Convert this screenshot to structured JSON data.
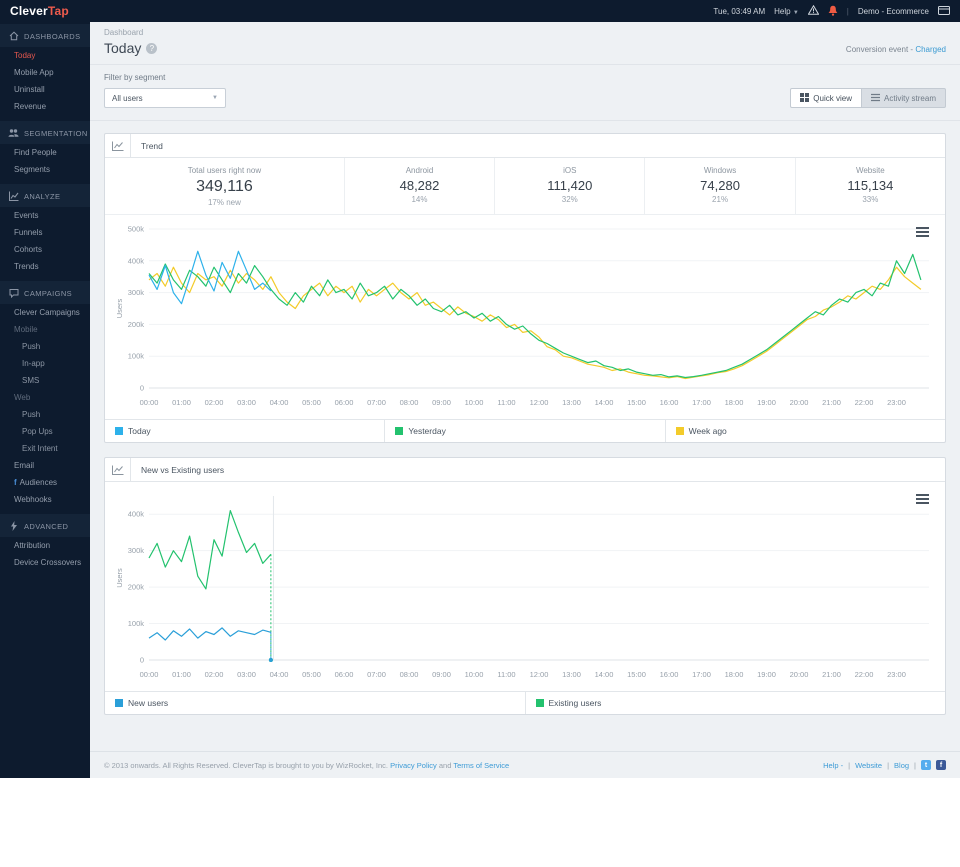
{
  "topbar": {
    "logo_part1": "Clever",
    "logo_part2": "Tap",
    "datetime": "Tue, 03:49 AM",
    "help_label": "Help",
    "account": "Demo - Ecommerce",
    "separator": "|"
  },
  "sidebar": {
    "sections": [
      {
        "label": "DASHBOARDS",
        "icon": "home-icon",
        "items": [
          {
            "label": "Today"
          },
          {
            "label": "Mobile App"
          },
          {
            "label": "Uninstall"
          },
          {
            "label": "Revenue"
          }
        ]
      },
      {
        "label": "SEGMENTATION",
        "icon": "people-icon",
        "items": [
          {
            "label": "Find People"
          },
          {
            "label": "Segments"
          }
        ]
      },
      {
        "label": "ANALYZE",
        "icon": "chart-icon",
        "items": [
          {
            "label": "Events"
          },
          {
            "label": "Funnels"
          },
          {
            "label": "Cohorts"
          },
          {
            "label": "Trends"
          }
        ]
      },
      {
        "label": "CAMPAIGNS",
        "icon": "chat-icon",
        "items": [
          {
            "label": "Clever Campaigns"
          },
          {
            "label": "Mobile"
          },
          {
            "label": "Push"
          },
          {
            "label": "In-app"
          },
          {
            "label": "SMS"
          },
          {
            "label": "Web"
          },
          {
            "label": "Push"
          },
          {
            "label": "Pop Ups"
          },
          {
            "label": "Exit Intent"
          },
          {
            "label": "Email"
          },
          {
            "label": "Audiences"
          },
          {
            "label": "Webhooks"
          }
        ]
      },
      {
        "label": "ADVANCED",
        "icon": "bolt-icon",
        "items": [
          {
            "label": "Attribution"
          },
          {
            "label": "Device Crossovers"
          }
        ]
      }
    ]
  },
  "header": {
    "breadcrumb": "Dashboard",
    "title": "Today",
    "conversion_label": "Conversion event -",
    "conversion_value": "Charged"
  },
  "filter": {
    "label": "Filter by segment",
    "value": "All users"
  },
  "view_toggle": {
    "quick": "Quick view",
    "activity": "Activity stream"
  },
  "stats": [
    {
      "label": "Total users right now",
      "value": "349,116",
      "sub": "17% new"
    },
    {
      "label": "Android",
      "value": "48,282",
      "sub": "14%"
    },
    {
      "label": "iOS",
      "value": "111,420",
      "sub": "32%"
    },
    {
      "label": "Windows",
      "value": "74,280",
      "sub": "21%"
    },
    {
      "label": "Website",
      "value": "115,134",
      "sub": "33%"
    }
  ],
  "chart_data": [
    {
      "type": "line",
      "title": "Trend",
      "ylabel": "Users",
      "value_unit": "thousands of users",
      "ylim": [
        0,
        500
      ],
      "yticks": [
        0,
        100,
        200,
        300,
        400,
        500
      ],
      "ytick_labels": [
        "0",
        "100k",
        "200k",
        "300k",
        "400k",
        "500k"
      ],
      "x_domain_hours": [
        0,
        24
      ],
      "xtick_labels": [
        "00:00",
        "01:00",
        "02:00",
        "03:00",
        "04:00",
        "05:00",
        "06:00",
        "07:00",
        "08:00",
        "09:00",
        "10:00",
        "11:00",
        "12:00",
        "13:00",
        "14:00",
        "15:00",
        "16:00",
        "17:00",
        "18:00",
        "19:00",
        "20:00",
        "21:00",
        "22:00",
        "23:00"
      ],
      "grid": true,
      "legend_position": "bottom",
      "series": [
        {
          "name": "Today",
          "color": "#2db1ea",
          "start_hour": 0,
          "step_hours": 0.25,
          "drop_to_zero": false,
          "values": [
            355,
            310,
            385,
            300,
            265,
            345,
            430,
            355,
            305,
            395,
            345,
            430,
            370,
            310,
            330,
            305
          ]
        },
        {
          "name": "Yesterday",
          "color": "#23c26e",
          "start_hour": 0,
          "step_hours": 0.25,
          "drop_to_zero": false,
          "values": [
            360,
            330,
            390,
            340,
            310,
            370,
            350,
            320,
            380,
            340,
            300,
            360,
            330,
            385,
            350,
            310,
            280,
            260,
            300,
            270,
            320,
            290,
            340,
            300,
            310,
            280,
            330,
            290,
            300,
            320,
            280,
            310,
            290,
            260,
            280,
            250,
            240,
            260,
            230,
            240,
            220,
            235,
            210,
            225,
            200,
            185,
            195,
            170,
            150,
            140,
            125,
            110,
            100,
            90,
            80,
            85,
            70,
            65,
            55,
            60,
            50,
            45,
            40,
            42,
            35,
            38,
            33,
            36,
            40,
            45,
            50,
            55,
            65,
            75,
            90,
            105,
            120,
            140,
            160,
            180,
            200,
            220,
            240,
            230,
            260,
            280,
            270,
            300,
            310,
            290,
            330,
            320,
            400,
            360,
            420,
            340
          ]
        },
        {
          "name": "Week ago",
          "color": "#f3cb2a",
          "start_hour": 0,
          "step_hours": 0.25,
          "drop_to_zero": false,
          "values": [
            340,
            360,
            320,
            380,
            330,
            300,
            360,
            340,
            350,
            320,
            370,
            330,
            360,
            340,
            310,
            350,
            300,
            270,
            250,
            290,
            310,
            330,
            290,
            320,
            300,
            320,
            270,
            310,
            290,
            310,
            330,
            300,
            280,
            300,
            260,
            270,
            250,
            230,
            255,
            235,
            225,
            210,
            230,
            215,
            190,
            200,
            175,
            180,
            160,
            130,
            120,
            100,
            95,
            85,
            75,
            70,
            65,
            55,
            60,
            50,
            45,
            40,
            38,
            35,
            32,
            36,
            30,
            34,
            38,
            42,
            48,
            52,
            60,
            70,
            85,
            100,
            115,
            135,
            155,
            175,
            195,
            215,
            225,
            245,
            255,
            270,
            290,
            280,
            300,
            320,
            310,
            340,
            380,
            350,
            330,
            310
          ]
        }
      ]
    },
    {
      "type": "line",
      "title": "New vs Existing users",
      "ylabel": "Users",
      "value_unit": "thousands of users",
      "ylim": [
        0,
        450
      ],
      "yticks": [
        0,
        100,
        200,
        300,
        400
      ],
      "ytick_labels": [
        "0",
        "100k",
        "200k",
        "300k",
        "400k"
      ],
      "x_domain_hours": [
        0,
        24
      ],
      "xtick_labels": [
        "00:00",
        "01:00",
        "02:00",
        "03:00",
        "04:00",
        "05:00",
        "06:00",
        "07:00",
        "08:00",
        "09:00",
        "10:00",
        "11:00",
        "12:00",
        "13:00",
        "14:00",
        "15:00",
        "16:00",
        "17:00",
        "18:00",
        "19:00",
        "20:00",
        "21:00",
        "22:00",
        "23:00"
      ],
      "grid": true,
      "legend_position": "bottom",
      "current_time_hour": 3.83,
      "series": [
        {
          "name": "New users",
          "color": "#2a9fd8",
          "start_hour": 0,
          "step_hours": 0.25,
          "drop_to_zero": true,
          "values": [
            60,
            75,
            55,
            80,
            65,
            85,
            60,
            78,
            70,
            88,
            65,
            80,
            75,
            70,
            82,
            76
          ]
        },
        {
          "name": "Existing users",
          "color": "#23c26e",
          "start_hour": 0,
          "step_hours": 0.25,
          "drop_to_zero": true,
          "values": [
            280,
            320,
            255,
            300,
            270,
            340,
            230,
            195,
            330,
            285,
            410,
            350,
            295,
            320,
            265,
            290
          ]
        }
      ]
    }
  ],
  "footer": {
    "copyright": "© 2013 onwards. All Rights Reserved. CleverTap is brought to you by WizRocket, Inc.",
    "privacy_link": "Privacy Policy",
    "and_text": "and",
    "terms_link": "Terms of Service",
    "help_label": "Help -",
    "website_label": "Website",
    "blog_label": "Blog",
    "separator": "|"
  }
}
